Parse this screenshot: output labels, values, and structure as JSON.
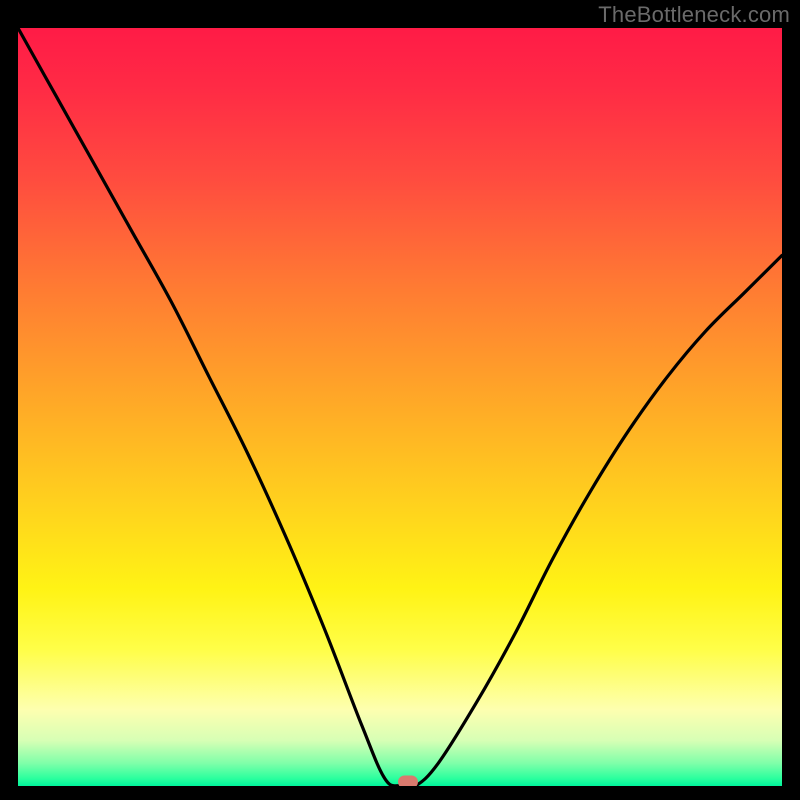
{
  "watermark": "TheBottleneck.com",
  "chart_data": {
    "type": "line",
    "title": "",
    "xlabel": "",
    "ylabel": "",
    "xlim": [
      0,
      100
    ],
    "ylim": [
      0,
      100
    ],
    "grid": false,
    "legend": false,
    "series": [
      {
        "name": "bottleneck-curve",
        "x": [
          0,
          5,
          10,
          15,
          20,
          25,
          30,
          35,
          40,
          45,
          48,
          50,
          52,
          55,
          60,
          65,
          70,
          75,
          80,
          85,
          90,
          95,
          100
        ],
        "y": [
          100,
          91,
          82,
          73,
          64,
          54,
          44,
          33,
          21,
          8,
          1,
          0,
          0,
          3,
          11,
          20,
          30,
          39,
          47,
          54,
          60,
          65,
          70
        ]
      }
    ],
    "marker": {
      "x_pct": 51,
      "y_pct": 0.5
    },
    "background_gradient": {
      "stops": [
        {
          "pos": 0.0,
          "color": "#ff1b46"
        },
        {
          "pos": 0.08,
          "color": "#ff2b45"
        },
        {
          "pos": 0.2,
          "color": "#ff4c3f"
        },
        {
          "pos": 0.34,
          "color": "#ff7a33"
        },
        {
          "pos": 0.48,
          "color": "#ffa528"
        },
        {
          "pos": 0.62,
          "color": "#ffcf1e"
        },
        {
          "pos": 0.74,
          "color": "#fff315"
        },
        {
          "pos": 0.82,
          "color": "#fffe48"
        },
        {
          "pos": 0.9,
          "color": "#fdffb0"
        },
        {
          "pos": 0.94,
          "color": "#d7ffb5"
        },
        {
          "pos": 0.97,
          "color": "#7fffa9"
        },
        {
          "pos": 0.99,
          "color": "#2bff9e"
        },
        {
          "pos": 1.0,
          "color": "#00f39b"
        }
      ]
    }
  },
  "colors": {
    "curve": "#000000",
    "marker": "#d97a6e",
    "watermark": "#6a6a6a",
    "frame": "#000000"
  }
}
